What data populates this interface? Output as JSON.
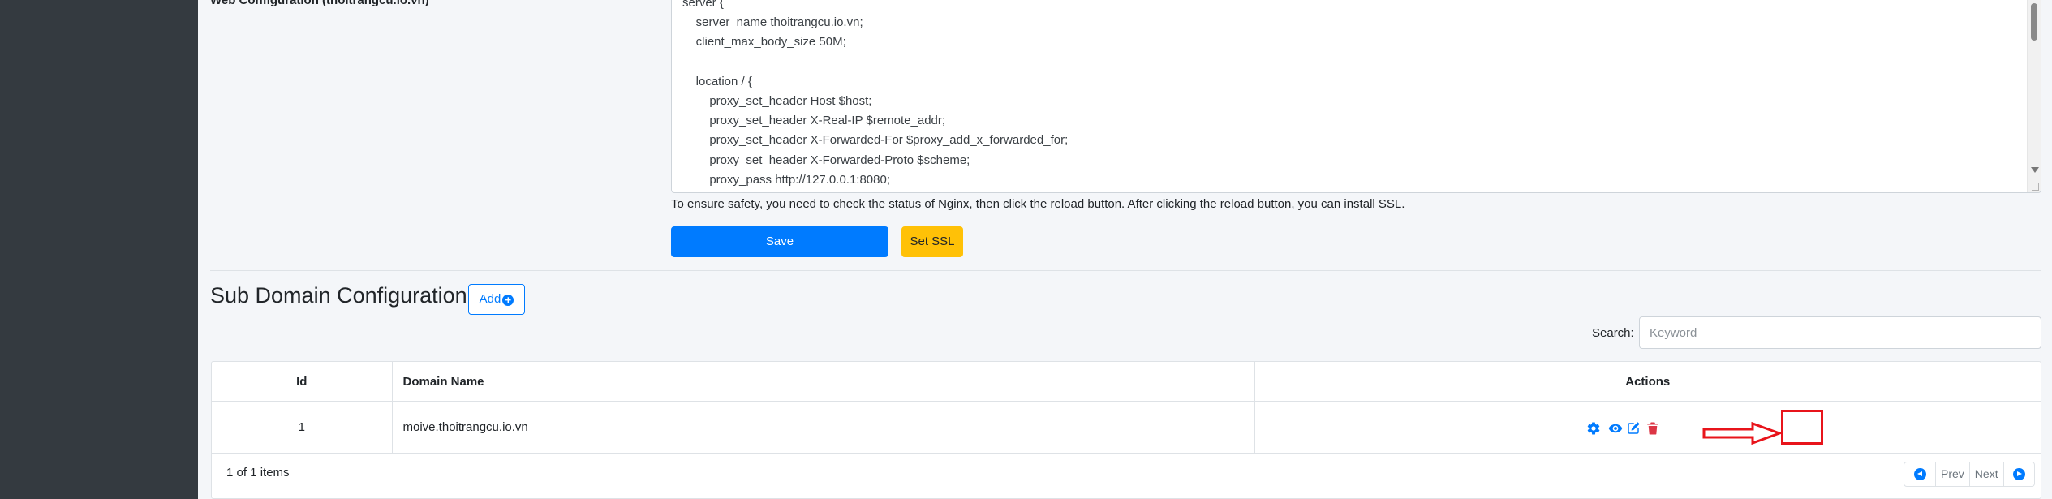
{
  "web_config": {
    "label": "Web Configuration (thoitrangcu.io.vn)",
    "code_lines": [
      "server {",
      "    server_name thoitrangcu.io.vn;",
      "    client_max_body_size 50M;",
      "",
      "    location / {",
      "        proxy_set_header Host $host;",
      "        proxy_set_header X-Real-IP $remote_addr;",
      "        proxy_set_header X-Forwarded-For $proxy_add_x_forwarded_for;",
      "        proxy_set_header X-Forwarded-Proto $scheme;",
      "        proxy_pass http://127.0.0.1:8080;"
    ],
    "help_text": "To ensure safety, you need to check the status of Nginx, then click the reload button. After clicking the reload button, you can install SSL.",
    "save_label": "Save",
    "ssl_label": "Set SSL"
  },
  "subdomain": {
    "title": "Sub Domain Configuration",
    "add_label": "Add",
    "search_label": "Search:",
    "search_placeholder": "Keyword",
    "columns": [
      "Id",
      "Domain Name",
      "Actions"
    ],
    "rows": [
      {
        "id": "1",
        "domain": "moive.thoitrangcu.io.vn"
      }
    ],
    "footer_count": "1 of 1 items",
    "pager": {
      "prev": "Prev",
      "next": "Next"
    }
  },
  "icons": {
    "settings": "gear-icon",
    "view": "eye-icon",
    "edit": "edit-icon",
    "delete": "trash-icon",
    "annotation": "red-arrow-icon"
  },
  "colors": {
    "primary": "#007bff",
    "warning": "#ffc107",
    "danger": "#dc3545",
    "sidebar": "#343a40",
    "annotation": "#e8141b"
  }
}
